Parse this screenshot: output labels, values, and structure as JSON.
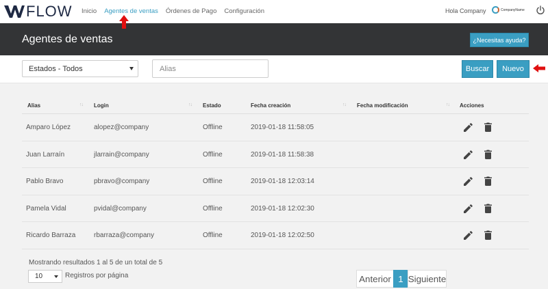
{
  "nav": {
    "brand": "FLOW",
    "links": [
      "Inicio",
      "Agentes de ventas",
      "Órdenes de Pago",
      "Configuración"
    ],
    "greeting": "Hola Company",
    "company_name": "CompanyName"
  },
  "header": {
    "title": "Agentes de ventas",
    "help_label": "¿Necesitas ayuda?"
  },
  "filters": {
    "status_select": "Estados - Todos",
    "alias_placeholder": "Alias",
    "search_label": "Buscar",
    "new_label": "Nuevo"
  },
  "table": {
    "columns": [
      "Alias",
      "Login",
      "Estado",
      "Fecha creación",
      "Fecha modificación",
      "Acciones"
    ],
    "rows": [
      {
        "alias": "Amparo López",
        "login": "alopez@company",
        "estado": "Offline",
        "creacion": "2019-01-18 11:58:05",
        "modificacion": ""
      },
      {
        "alias": "Juan Larraín",
        "login": "jlarrain@company",
        "estado": "Offline",
        "creacion": "2019-01-18 11:58:38",
        "modificacion": ""
      },
      {
        "alias": "Pablo Bravo",
        "login": "pbravo@company",
        "estado": "Offline",
        "creacion": "2019-01-18 12:03:14",
        "modificacion": ""
      },
      {
        "alias": "Pamela Vidal",
        "login": "pvidal@company",
        "estado": "Offline",
        "creacion": "2019-01-18 12:02:30",
        "modificacion": ""
      },
      {
        "alias": "Ricardo Barraza",
        "login": "rbarraza@company",
        "estado": "Offline",
        "creacion": "2019-01-18 12:02:50",
        "modificacion": ""
      }
    ]
  },
  "footer": {
    "results_text": "Mostrando resultados 1 al 5 de un total de 5",
    "per_page_value": "10",
    "per_page_label": "Registros por página",
    "prev_label": "Anterior",
    "current_page": "1",
    "next_label": "Siguiente"
  },
  "colors": {
    "accent": "#3a9ec2",
    "header_band": "#333436",
    "annotation": "#e01010"
  },
  "icons": [
    "power-icon",
    "edit-pencil-icon",
    "trash-icon",
    "arrow-up-annotation",
    "arrow-left-annotation"
  ]
}
